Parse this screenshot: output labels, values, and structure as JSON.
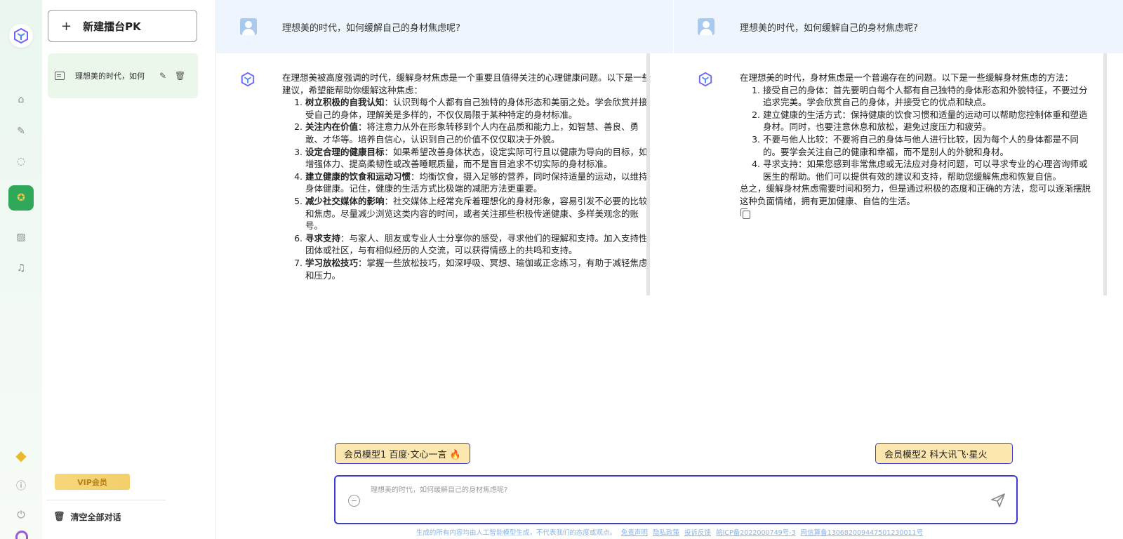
{
  "sidebar": {
    "new_pk_label": "新建擂台PK",
    "session_title": "理想美的时代，如何",
    "vip_label": "VIP会员",
    "clear_all_label": "清空全部对话"
  },
  "left": {
    "question": "理想美的时代，如何缓解自己的身材焦虑呢?",
    "intro": "在理想美被高度强调的时代，缓解身材焦虑是一个重要且值得关注的心理健康问题。以下是一些建议，希望能帮助你缓解这种焦虑：",
    "items": [
      {
        "title": "树立积极的自我认知",
        "text": "：认识到每个人都有自己独特的身体形态和美丽之处。学会欣赏并接受自己的身体，理解美是多样的，不仅仅局限于某种特定的身材标准。"
      },
      {
        "title": "关注内在价值",
        "text": "：将注意力从外在形象转移到个人内在品质和能力上，如智慧、善良、勇敢、才华等。培养自信心，认识到自己的价值不仅仅取决于外貌。"
      },
      {
        "title": "设定合理的健康目标",
        "text": "：如果希望改善身体状态，设定实际可行且以健康为导向的目标，如增强体力、提高柔韧性或改善睡眠质量，而不是盲目追求不切实际的身材标准。"
      },
      {
        "title": "建立健康的饮食和运动习惯",
        "text": "：均衡饮食，摄入足够的营养，同时保持适量的运动，以维持身体健康。记住，健康的生活方式比极端的减肥方法更重要。"
      },
      {
        "title": "减少社交媒体的影响",
        "text": "：社交媒体上经常充斥着理想化的身材形象，容易引发不必要的比较和焦虑。尽量减少浏览这类内容的时间，或者关注那些积极传递健康、多样美观念的账号。"
      },
      {
        "title": "寻求支持",
        "text": "：与家人、朋友或专业人士分享你的感受，寻求他们的理解和支持。加入支持性团体或社区，与有相似经历的人交流，可以获得情感上的共鸣和支持。"
      },
      {
        "title": "学习放松技巧",
        "text": "：掌握一些放松技巧，如深呼吸、冥想、瑜伽或正念练习，有助于减轻焦虑和压力。"
      }
    ],
    "model_label": "会员模型1 百度·文心一言 🔥"
  },
  "right": {
    "question": "理想美的时代，如何缓解自己的身材焦虑呢?",
    "intro": "在理想美的时代，身材焦虑是一个普遍存在的问题。以下是一些缓解身材焦虑的方法：",
    "items": [
      "接受自己的身体：首先要明白每个人都有自己独特的身体形态和外貌特征，不要过分追求完美。学会欣赏自己的身体，并接受它的优点和缺点。",
      "建立健康的生活方式：保持健康的饮食习惯和适量的运动可以帮助您控制体重和塑造身材。同时，也要注意休息和放松，避免过度压力和疲劳。",
      "不要与他人比较：不要将自己的身体与他人进行比较，因为每个人的身体都是不同的。要学会关注自己的健康和幸福，而不是别人的外貌和身材。",
      "寻求支持：如果您感到非常焦虑或无法应对身材问题，可以寻求专业的心理咨询师或医生的帮助。他们可以提供有效的建议和支持，帮助您缓解焦虑和恢复自信。"
    ],
    "conclusion": "总之，缓解身材焦虑需要时间和努力，但是通过积极的态度和正确的方法，您可以逐渐摆脱这种负面情绪，拥有更加健康、自信的生活。",
    "model_label": "会员模型2 科大讯飞·星火"
  },
  "input": {
    "placeholder": "理想美的时代，如何缓解自己的身材焦虑呢?"
  },
  "footer": {
    "notice": "生成的所有内容均由人工智能模型生成，不代表我们的态度或观点。",
    "links": [
      "免责声明",
      "隐私政策",
      "投诉反馈",
      "皖ICP备2022000749号-3",
      "网信算备130682009447501230011号"
    ]
  },
  "colors": {
    "accent_green": "#2fa85a",
    "primary_blue": "#3b3bd6",
    "model_tag_bg": "#fde7b0",
    "question_bar_bg": "#eef5fd"
  }
}
